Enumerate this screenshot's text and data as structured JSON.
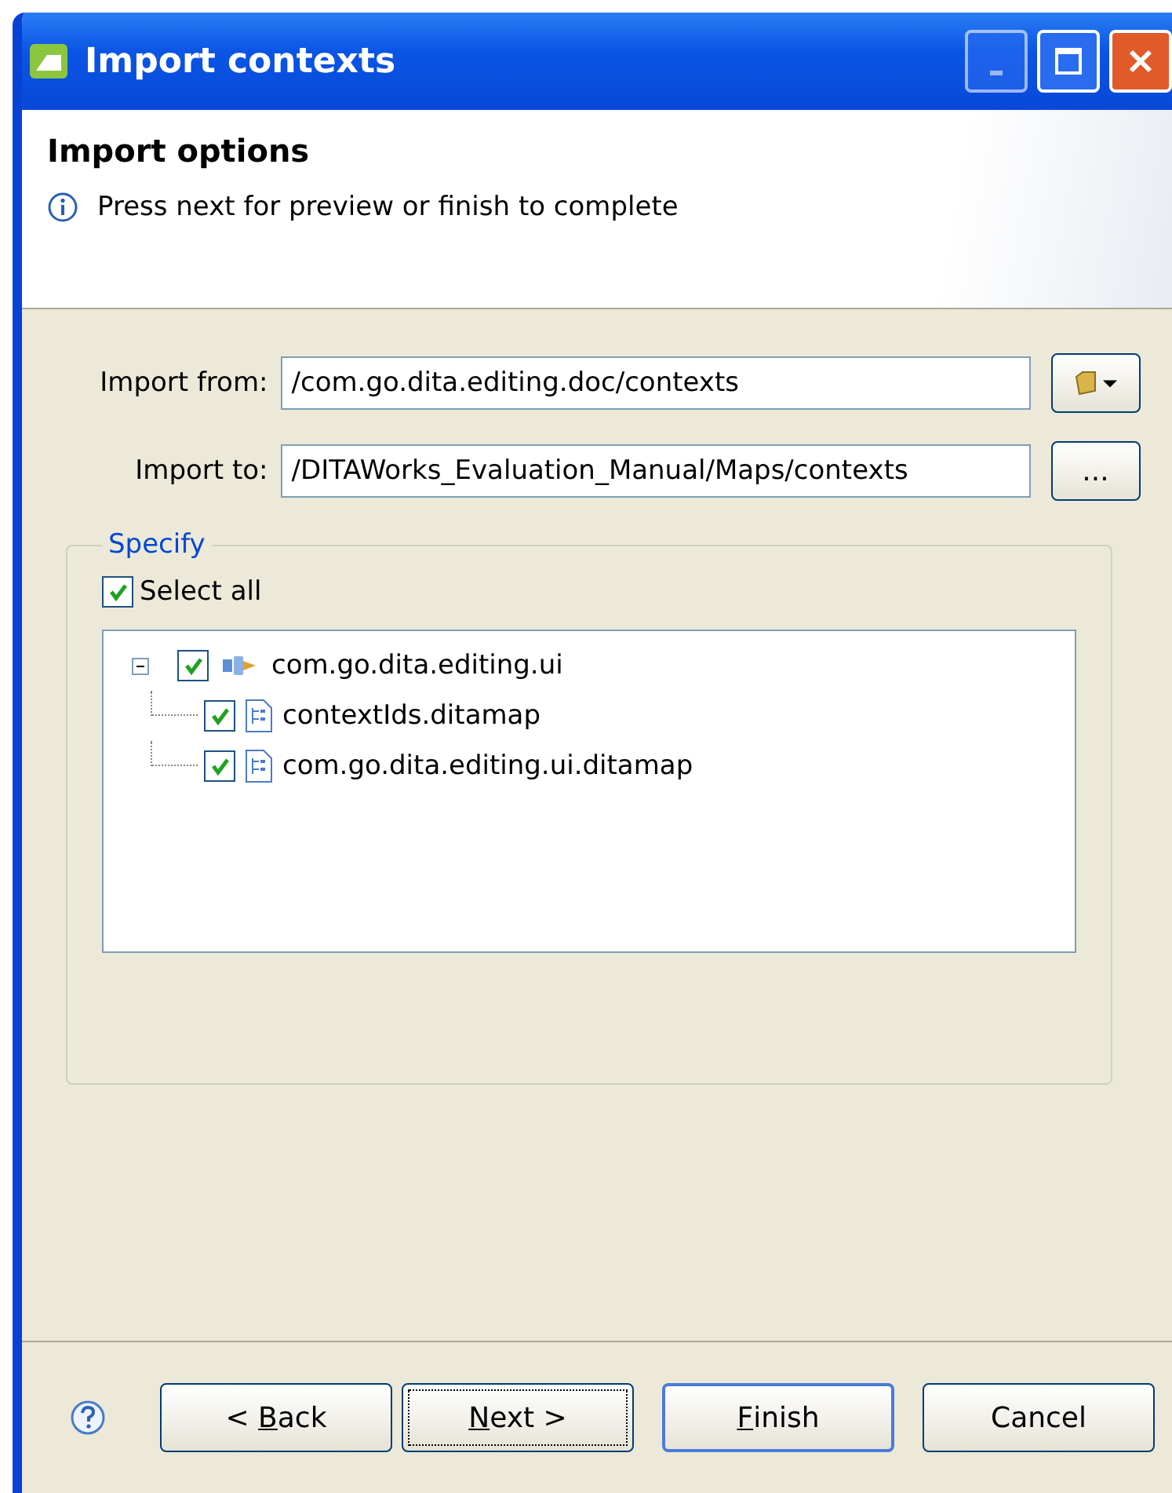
{
  "window": {
    "title": "Import contexts"
  },
  "header": {
    "title": "Import options",
    "message": "Press next for preview or finish to complete"
  },
  "fields": [
    {
      "label": "Import from:",
      "value": "/com.go.dita.editing.doc/contexts",
      "button": {
        "kind": "folder-menu"
      }
    },
    {
      "label": "Import to:",
      "value": "/DITAWorks_Evaluation_Manual/Maps/contexts",
      "button": {
        "kind": "browse",
        "label": "..."
      }
    }
  ],
  "group": {
    "title": "Specify",
    "select_all": {
      "label": "Select all",
      "checked": true
    },
    "tree": [
      {
        "label": "com.go.dita.editing.ui",
        "kind": "plugin",
        "checked": true,
        "expanded": true,
        "children": [
          {
            "label": "contextIds.ditamap",
            "kind": "map",
            "checked": true
          },
          {
            "label": "com.go.dita.editing.ui.ditamap",
            "kind": "map",
            "checked": true
          }
        ]
      }
    ]
  },
  "buttons": [
    {
      "before": "< ",
      "key": "B",
      "after": "ack",
      "focused": false,
      "default": false
    },
    {
      "key": "N",
      "after": "ext >",
      "focused": true,
      "default": false
    },
    {
      "key": "F",
      "after": "inish",
      "focused": false,
      "default": true
    },
    {
      "before": "Cancel",
      "focused": false,
      "default": false
    }
  ]
}
